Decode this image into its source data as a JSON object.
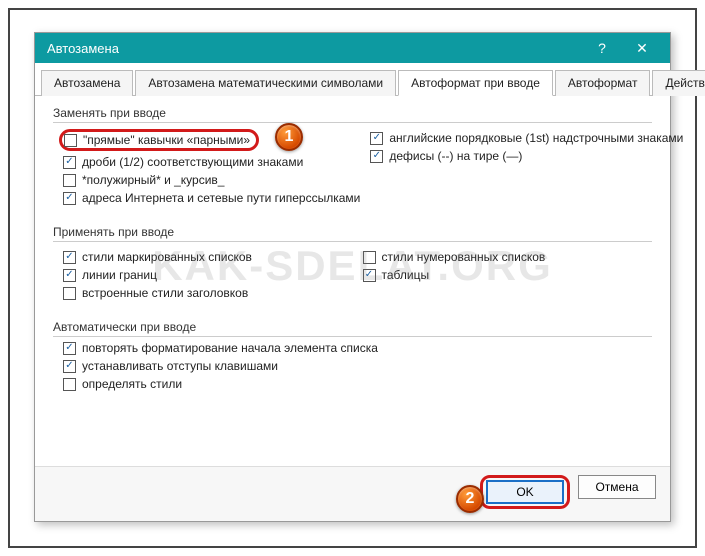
{
  "window": {
    "title": "Автозамена",
    "help": "?",
    "close": "✕"
  },
  "tabs": [
    "Автозамена",
    "Автозамена математическими символами",
    "Автоформат при вводе",
    "Автоформат",
    "Действия"
  ],
  "active_tab": 2,
  "groups": {
    "replace": {
      "title": "Заменять при вводе",
      "left": [
        {
          "checked": false,
          "label": "\"прямые\" кавычки «парными»"
        },
        {
          "checked": true,
          "label": "дроби (1/2) соответствующими знаками"
        },
        {
          "checked": false,
          "label": "*полужирный* и _курсив_"
        },
        {
          "checked": true,
          "label": "адреса Интернета и сетевые пути гиперссылками"
        }
      ],
      "right": [
        {
          "checked": true,
          "label": "английские порядковые (1st) надстрочными знаками"
        },
        {
          "checked": true,
          "label": "дефисы (--) на тире (—)"
        }
      ]
    },
    "apply": {
      "title": "Применять при вводе",
      "left": [
        {
          "checked": true,
          "label": "стили маркированных списков"
        },
        {
          "checked": true,
          "label": "линии границ"
        },
        {
          "checked": false,
          "label": "встроенные стили заголовков"
        }
      ],
      "right": [
        {
          "checked": false,
          "label": "стили нумерованных списков"
        },
        {
          "checked": true,
          "label": "таблицы"
        }
      ]
    },
    "auto": {
      "title": "Автоматически при вводе",
      "items": [
        {
          "checked": true,
          "label": "повторять форматирование начала элемента списка"
        },
        {
          "checked": true,
          "label": "устанавливать отступы клавишами"
        },
        {
          "checked": false,
          "label": "определять стили"
        }
      ]
    }
  },
  "buttons": {
    "ok": "OK",
    "cancel": "Отмена"
  },
  "badges": {
    "one": "1",
    "two": "2"
  },
  "watermark": "KAK-SDELAT.ORG"
}
